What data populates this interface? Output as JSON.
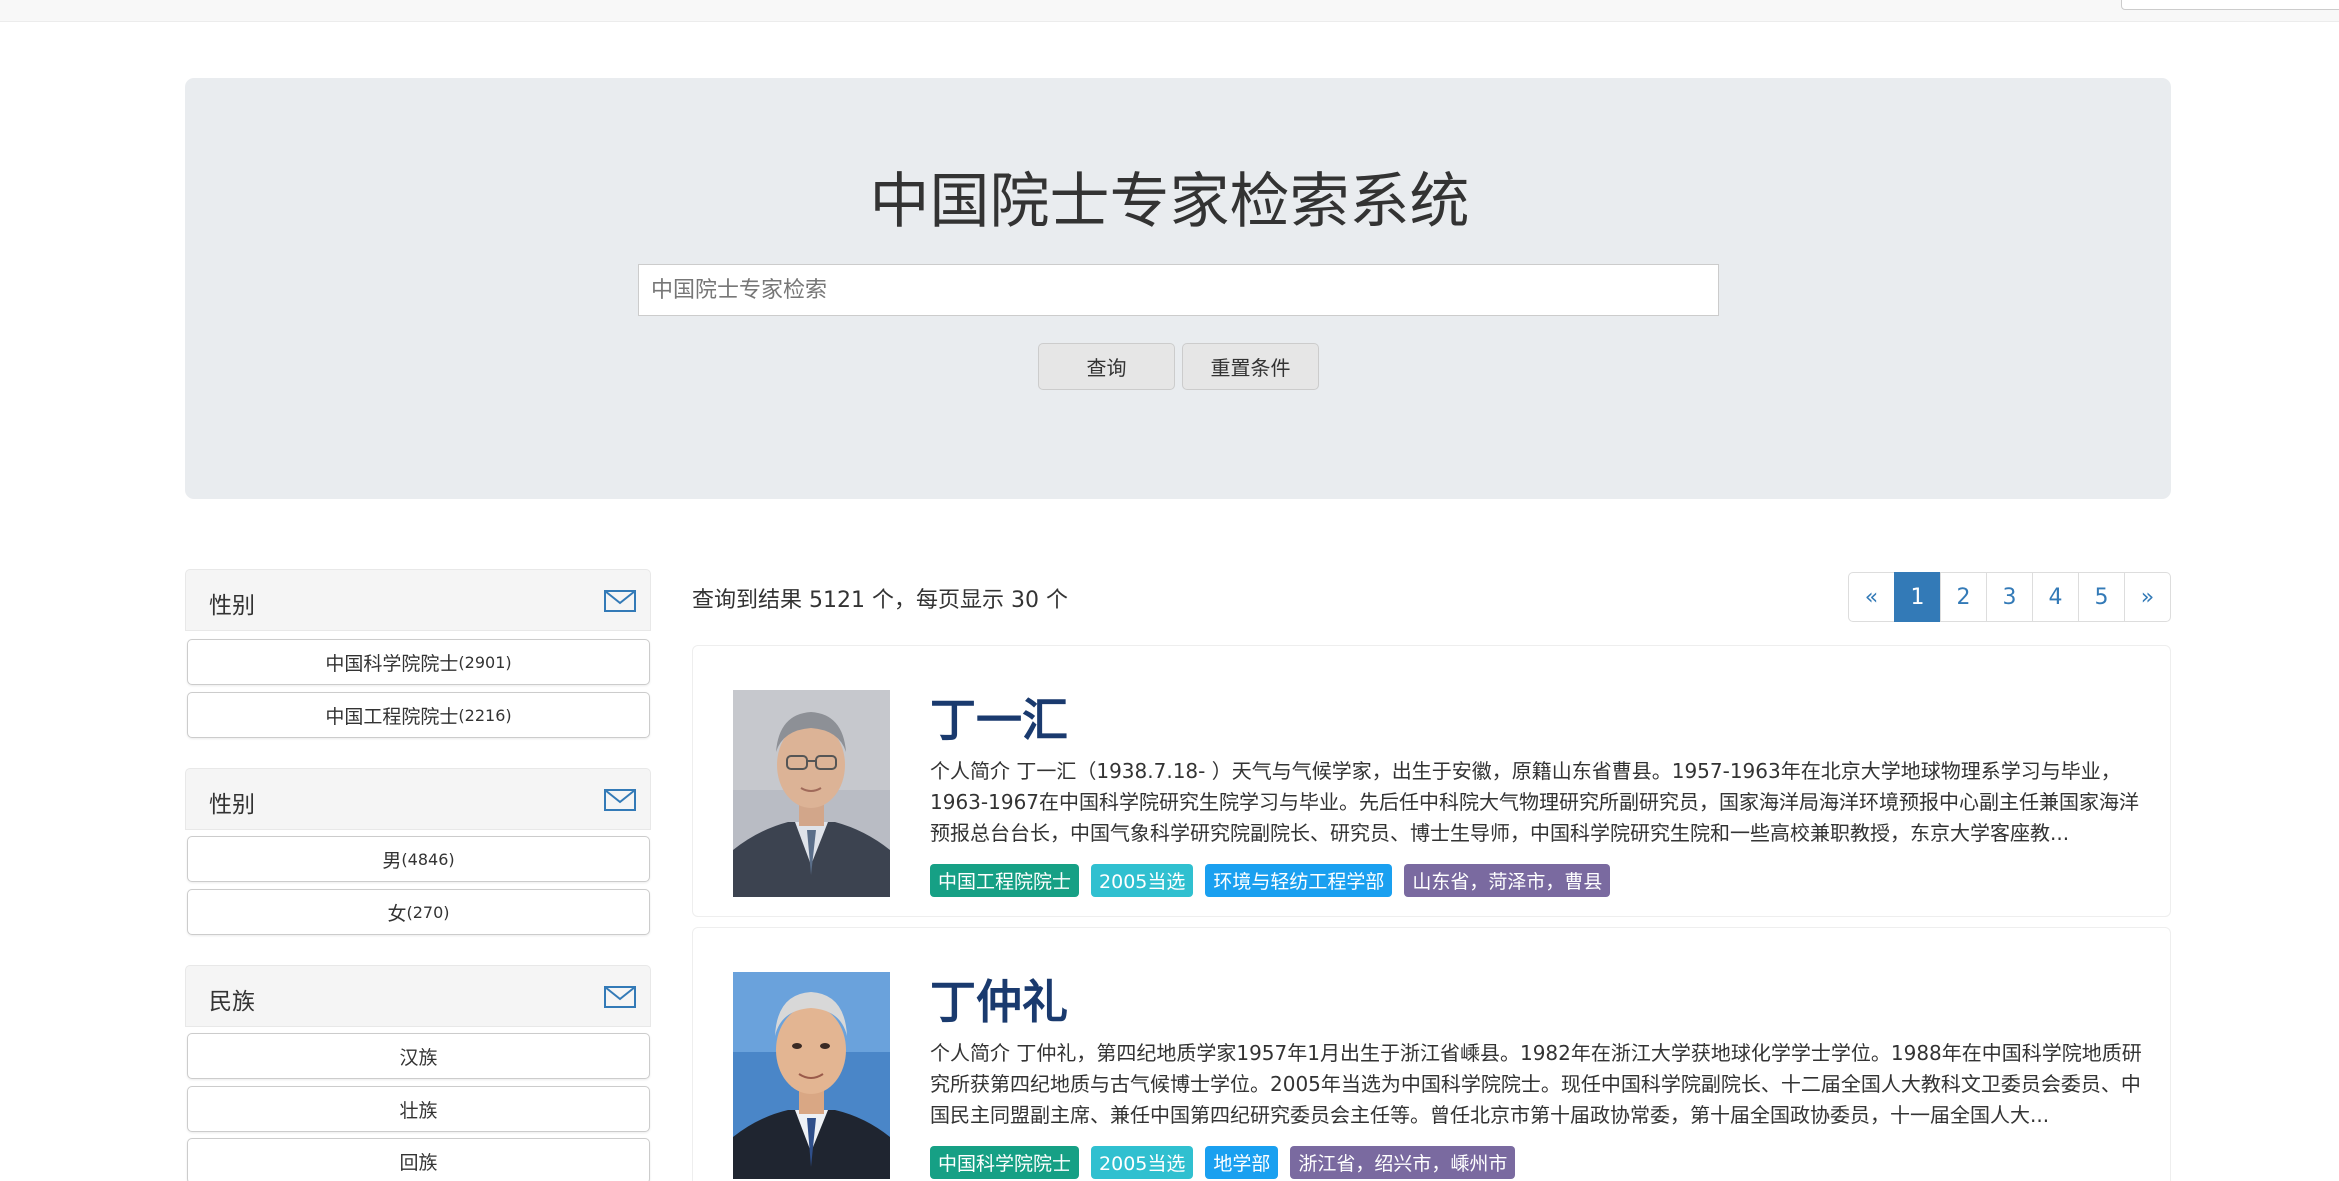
{
  "colors": {
    "tag_academy": "#16a085",
    "tag_year": "#30c0d0",
    "tag_dept": "#1aa0f0",
    "tag_region": "#7a6aa0",
    "page_active": "#337ab7",
    "name": "#1a3a6e"
  },
  "header": {
    "title": "中国院士专家检索系统",
    "search_placeholder": "中国院士专家检索",
    "query_label": "查询",
    "reset_label": "重置条件"
  },
  "facets": [
    {
      "title": "性别",
      "toggle_icon": "envelope-icon",
      "items": [
        {
          "label": "中国科学院院士",
          "count": "(2901)"
        },
        {
          "label": "中国工程院院士",
          "count": "(2216)"
        }
      ]
    },
    {
      "title": "性别",
      "toggle_icon": "envelope-icon",
      "items": [
        {
          "label": "男",
          "count": "(4846)"
        },
        {
          "label": "女",
          "count": "(270)"
        }
      ]
    },
    {
      "title": "民族",
      "toggle_icon": "envelope-icon",
      "items": [
        {
          "label": "汉族",
          "count": ""
        },
        {
          "label": "壮族",
          "count": ""
        },
        {
          "label": "回族",
          "count": ""
        }
      ]
    }
  ],
  "results": {
    "summary": "查询到结果 5121 个，每页显示 30 个",
    "pagination": [
      "«",
      "1",
      "2",
      "3",
      "4",
      "5",
      "»"
    ],
    "active_page": "1",
    "items": [
      {
        "name": "丁一汇",
        "bio": "个人简介 丁一汇（1938.7.18- ）天气与气候学家，出生于安徽，原籍山东省曹县。1957-1963年在北京大学地球物理系学习与毕业，1963-1967在中国科学院研究生院学习与毕业。先后任中科院大气物理研究所副研究员，国家海洋局海洋环境预报中心副主任兼国家海洋预报总台台长，中国气象科学研究院副院长、研究员、博士生导师，中国科学院研究生院和一些高校兼职教授，东京大学客座教...",
        "tags": [
          "中国工程院院士",
          "2005当选",
          "环境与轻纺工程学部",
          "山东省，菏泽市，曹县"
        ]
      },
      {
        "name": "丁仲礼",
        "bio": "个人简介 丁仲礼，第四纪地质学家1957年1月出生于浙江省嵊县。1982年在浙江大学获地球化学学士学位。1988年在中国科学院地质研究所获第四纪地质与古气候博士学位。2005年当选为中国科学院院士。现任中国科学院副院长、十二届全国人大教科文卫委员会委员、中国民主同盟副主席、兼任中国第四纪研究委员会主任等。曾任北京市第十届政协常委，第十届全国政协委员，十一届全国人大...",
        "tags": [
          "中国科学院院士",
          "2005当选",
          "地学部",
          "浙江省，绍兴市，嵊州市"
        ]
      }
    ]
  }
}
